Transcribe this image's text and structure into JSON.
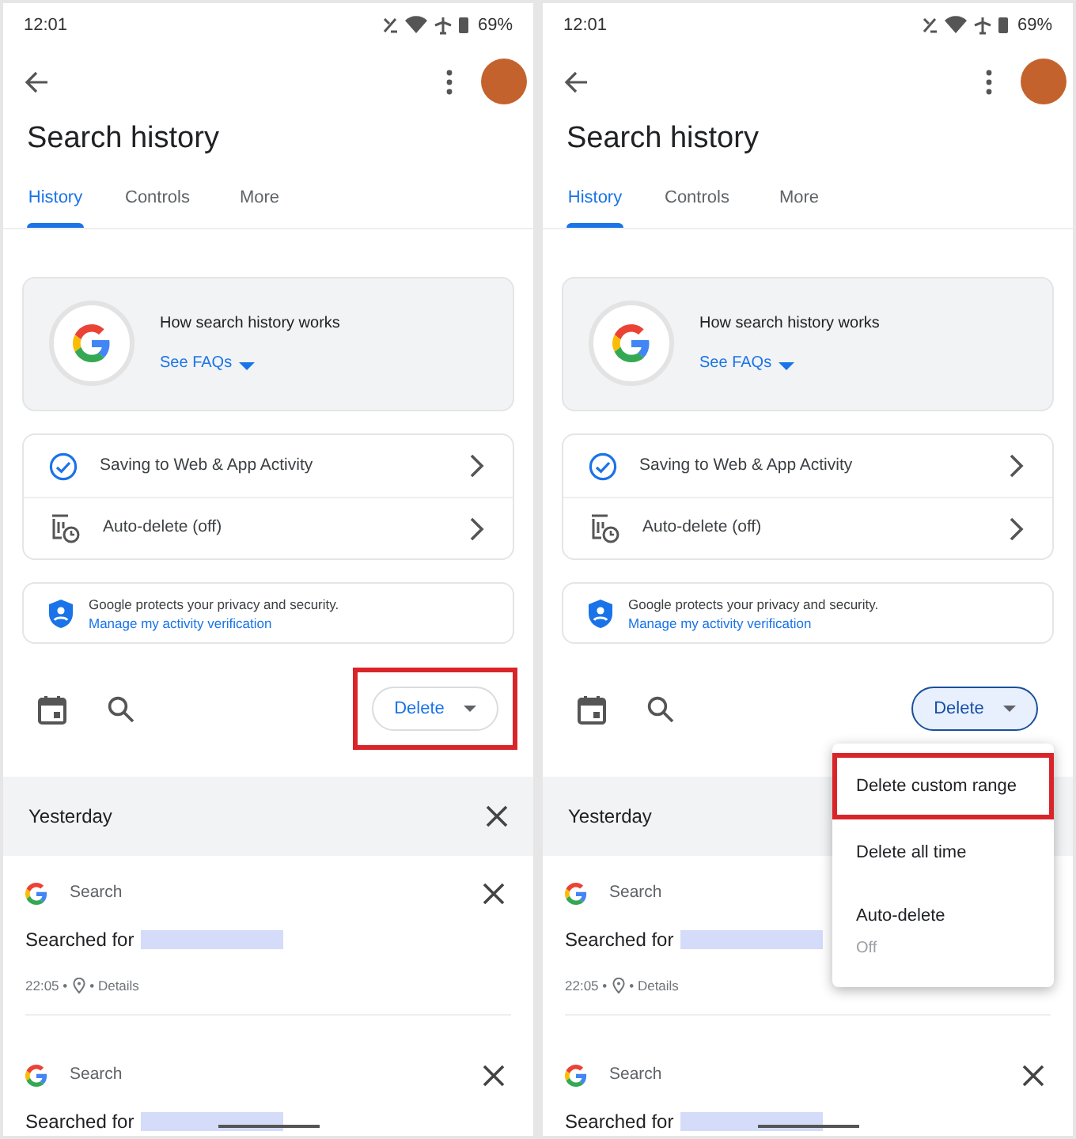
{
  "screens": [
    {
      "status_bar": {
        "time": "12:01",
        "battery": "69%"
      },
      "title": "Search history",
      "tabs": [
        {
          "label": "History",
          "selected": true
        },
        {
          "label": "Controls",
          "selected": false
        },
        {
          "label": "More",
          "selected": false
        }
      ],
      "info_card": {
        "title": "How search history works",
        "link": "See FAQs"
      },
      "settings": [
        {
          "kind": "activity",
          "label": "Saving to Web & App Activity"
        },
        {
          "kind": "autodelete",
          "label": "Auto-delete (off)"
        }
      ],
      "privacy": {
        "text": "Google protects your privacy and security.",
        "link": "Manage my activity verification"
      },
      "delete_button": {
        "label": "Delete",
        "open": false,
        "highlighted": true
      },
      "section": {
        "label": "Yesterday"
      },
      "items": [
        {
          "source": "Search",
          "text": "Searched for",
          "time": "22:05 •",
          "details": "• Details"
        },
        {
          "source": "Search",
          "text": "Searched for"
        }
      ]
    },
    {
      "status_bar": {
        "time": "12:01",
        "battery": "69%"
      },
      "title": "Search history",
      "tabs": [
        {
          "label": "History",
          "selected": true
        },
        {
          "label": "Controls",
          "selected": false
        },
        {
          "label": "More",
          "selected": false
        }
      ],
      "info_card": {
        "title": "How search history works",
        "link": "See FAQs"
      },
      "settings": [
        {
          "kind": "activity",
          "label": "Saving to Web & App Activity"
        },
        {
          "kind": "autodelete",
          "label": "Auto-delete (off)"
        }
      ],
      "privacy": {
        "text": "Google protects your privacy and security.",
        "link": "Manage my activity verification"
      },
      "delete_button": {
        "label": "Delete",
        "open": true,
        "highlighted": false
      },
      "menu": [
        {
          "label": "Delete custom range",
          "highlighted": true
        },
        {
          "label": "Delete all time",
          "highlighted": false
        },
        {
          "label": "Auto-delete",
          "sub": "Off",
          "highlighted": false
        }
      ],
      "section": {
        "label": "Yesterday"
      },
      "items": [
        {
          "source": "Search",
          "text": "Searched for",
          "time": "22:05 •",
          "details": "• Details"
        },
        {
          "source": "Search",
          "text": "Searched for"
        }
      ]
    }
  ]
}
